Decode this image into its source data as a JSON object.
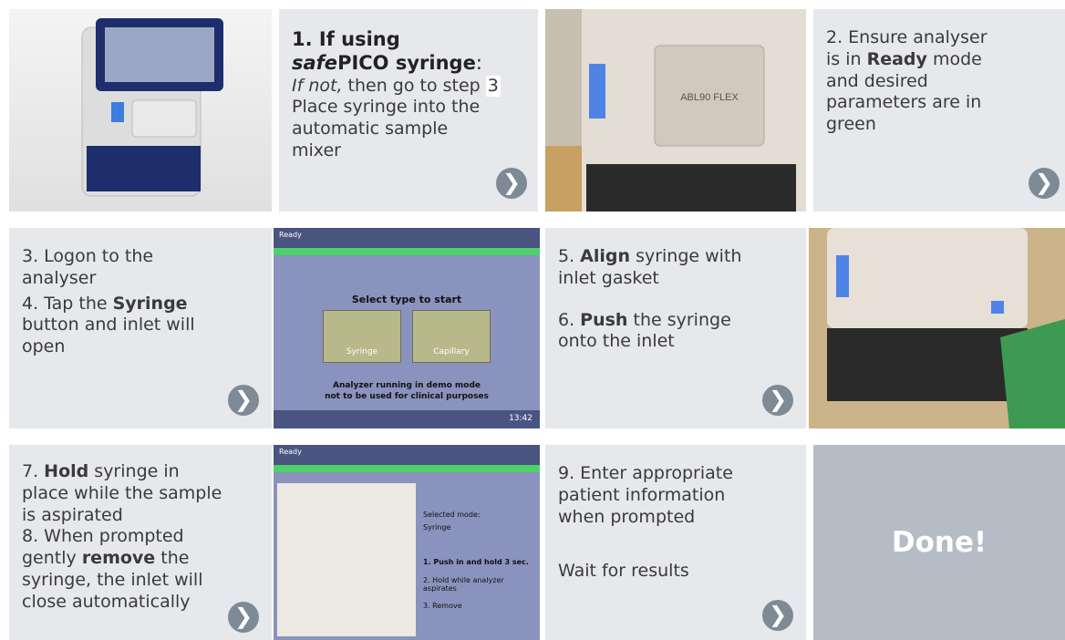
{
  "step1": {
    "title_a": "1. If using",
    "title_b_italic": "safe",
    "title_b_bold": "PICO syringe",
    "title_b_colon": ":",
    "line_ifnot_italic": "If not,",
    "line_ifnot_rest": " then go to step",
    "step_ref": "3",
    "line3": "Place syringe into the",
    "line4": "automatic sample",
    "line5": "mixer"
  },
  "step2": {
    "l1": "2. Ensure analyser",
    "l2a": "is in ",
    "l2b": "Ready",
    "l2c": " mode",
    "l3": "and desired",
    "l4": "parameters are in",
    "l5": "green"
  },
  "step34": {
    "l1": "3. Logon to the",
    "l2": "analyser",
    "l3a": "4. Tap the ",
    "l3b": "Syringe",
    "l4": "button and inlet will",
    "l5": "open"
  },
  "screen1": {
    "status": "Ready",
    "prompt": "Select type to start",
    "btn1": "Syringe",
    "btn2": "Capillary",
    "warn1": "Analyzer running in demo mode",
    "warn2": "not to be used for clinical purposes",
    "time": "13:42"
  },
  "step56": {
    "l1a": "5. ",
    "l1b": "Align",
    "l1c": " syringe with",
    "l2": "inlet gasket",
    "l3a": "6. ",
    "l3b": "Push",
    "l3c": " the syringe",
    "l4": "onto the inlet"
  },
  "step78": {
    "l1a": "7. ",
    "l1b": "Hold",
    "l1c": " syringe in",
    "l2": "place while the sample",
    "l3": "is aspirated",
    "l4": "8. When prompted",
    "l5a": "gently ",
    "l5b": "remove",
    "l5c": " the",
    "l6": "syringe, the inlet will",
    "l7": "close automatically"
  },
  "screen2": {
    "status": "Ready",
    "mode_label": "Selected mode:",
    "mode_value": "Syringe",
    "s1": "1. Push in and hold 3 sec.",
    "s2": "2. Hold while analyzer aspirates",
    "s3": "3. Remove"
  },
  "step9": {
    "l1": "9. Enter appropriate",
    "l2": "patient information",
    "l3": "when prompted",
    "l4": "Wait for results"
  },
  "done": {
    "label": "Done!"
  },
  "device_label": {
    "model": "ABL90 FLEX"
  },
  "next_glyph": "❯",
  "colors": {
    "tile_bg": "#e6e8eb",
    "arrow": "#7e8a96",
    "done_bg": "#b5bcc5",
    "screen_bg": "#8a93bd",
    "screen_green": "#4fd16a"
  }
}
